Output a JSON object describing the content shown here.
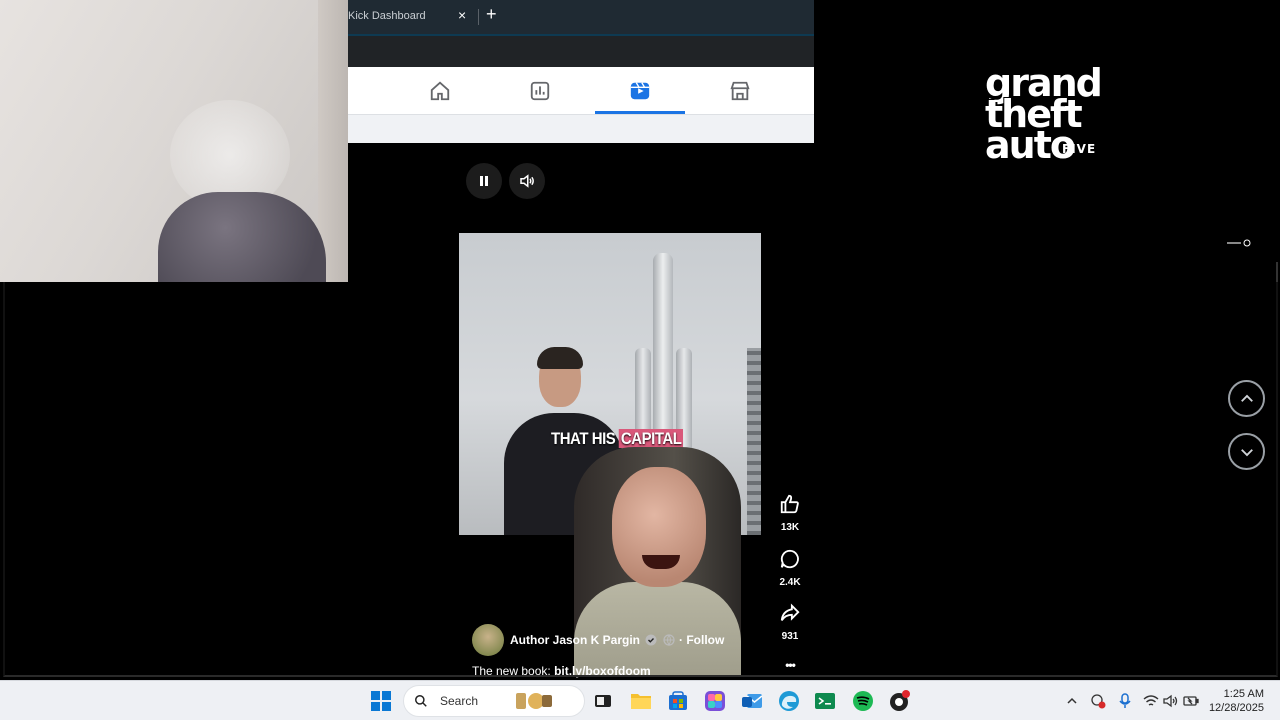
{
  "browser": {
    "tab_title": "Kick Dashboard",
    "close_glyph": "×",
    "new_tab_glyph": "+"
  },
  "facebook_nav": {
    "items": [
      {
        "name": "home",
        "icon": "home-icon"
      },
      {
        "name": "dashboard",
        "icon": "chart-icon"
      },
      {
        "name": "reels",
        "icon": "reels-icon",
        "active": true
      },
      {
        "name": "marketplace",
        "icon": "store-icon"
      }
    ],
    "accent": "#1b74e4"
  },
  "player": {
    "caption_prefix": "THAT HIS ",
    "caption_highlight": "CAPITAL",
    "highlight_color": "#d9587a"
  },
  "actions": {
    "likes": "13K",
    "comments": "2.4K",
    "shares": "931",
    "more": "•••"
  },
  "author": {
    "name": "Author Jason K Pargin",
    "follow": "· Follow"
  },
  "description": {
    "prefix": "The new book: ",
    "link": "bit.ly/boxofdoom"
  },
  "overlay": {
    "gta_line1": "grand",
    "gta_line2": "theft",
    "gta_line3": "auto",
    "gta_five": "FIVE"
  },
  "taskbar": {
    "search_label": "Search",
    "time": "1:25 AM",
    "date": "12/28/2025"
  }
}
